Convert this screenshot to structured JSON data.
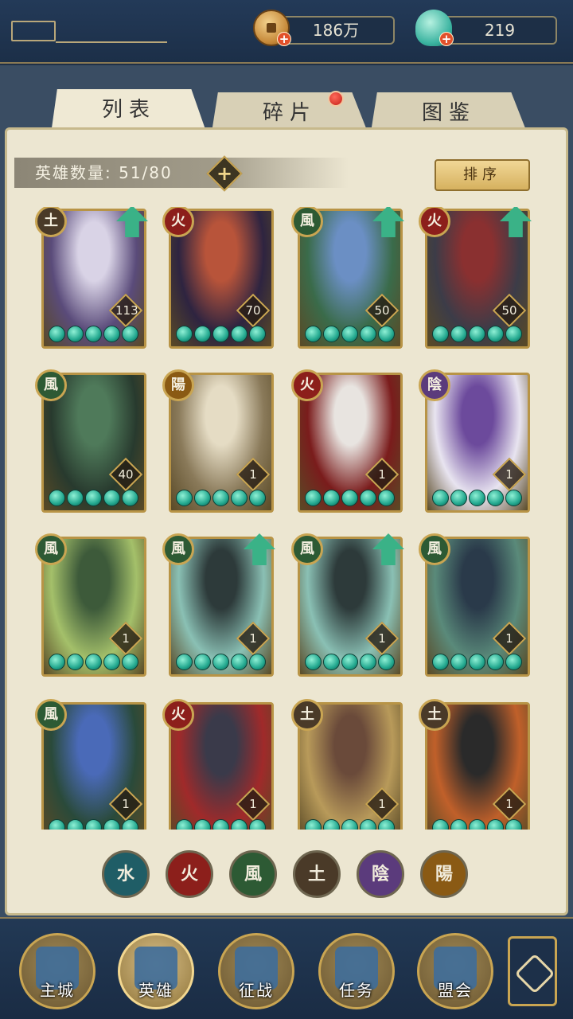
{
  "resources": {
    "coin": "186万",
    "jade": "219"
  },
  "tabs": [
    "列表",
    "碎片",
    "图鉴"
  ],
  "hero_count_label": "英雄数量: 51/80",
  "sort_label": "排序",
  "elements": {
    "earth": "土",
    "fire": "火",
    "wind": "風",
    "yin": "陰",
    "yang": "陽",
    "water": "水"
  },
  "heroes": [
    {
      "element": "earth",
      "glyph": "土",
      "level": "113",
      "upgrade": true,
      "colors": [
        "#d9d3e6",
        "#5a4b7a"
      ]
    },
    {
      "element": "fire",
      "glyph": "火",
      "level": "70",
      "upgrade": false,
      "colors": [
        "#b8543a",
        "#2e2440"
      ]
    },
    {
      "element": "wind",
      "glyph": "風",
      "level": "50",
      "upgrade": true,
      "colors": [
        "#6b8fc4",
        "#3a6b4a"
      ]
    },
    {
      "element": "fire",
      "glyph": "火",
      "level": "50",
      "upgrade": true,
      "colors": [
        "#8a3030",
        "#3c3c48"
      ]
    },
    {
      "element": "wind",
      "glyph": "風",
      "level": "40",
      "upgrade": false,
      "colors": [
        "#4f7a5a",
        "#283a2e"
      ]
    },
    {
      "element": "yang",
      "glyph": "陽",
      "level": "1",
      "upgrade": false,
      "colors": [
        "#e5dcc4",
        "#8a7a5a"
      ]
    },
    {
      "element": "fire",
      "glyph": "火",
      "level": "1",
      "upgrade": false,
      "colors": [
        "#e8e4e0",
        "#7a1c1c"
      ]
    },
    {
      "element": "yin",
      "glyph": "陰",
      "level": "1",
      "upgrade": false,
      "colors": [
        "#6c4a9c",
        "#e8e4f0"
      ]
    },
    {
      "element": "wind",
      "glyph": "風",
      "level": "1",
      "upgrade": false,
      "colors": [
        "#3d5a3a",
        "#a4c06a"
      ]
    },
    {
      "element": "wind",
      "glyph": "風",
      "level": "1",
      "upgrade": true,
      "colors": [
        "#2d3a3a",
        "#8ac0b4"
      ]
    },
    {
      "element": "wind",
      "glyph": "風",
      "level": "1",
      "upgrade": true,
      "colors": [
        "#2d3a3a",
        "#8ac0b4"
      ]
    },
    {
      "element": "wind",
      "glyph": "風",
      "level": "1",
      "upgrade": false,
      "colors": [
        "#2a3a4a",
        "#5a8a7a"
      ]
    },
    {
      "element": "wind",
      "glyph": "風",
      "level": "1",
      "upgrade": false,
      "colors": [
        "#4a6ab8",
        "#2a4a3a"
      ]
    },
    {
      "element": "fire",
      "glyph": "火",
      "level": "1",
      "upgrade": false,
      "colors": [
        "#3a3a4a",
        "#a02a2a"
      ]
    },
    {
      "element": "earth",
      "glyph": "土",
      "level": "1",
      "upgrade": false,
      "colors": [
        "#6a4a3a",
        "#b89a5a"
      ]
    },
    {
      "element": "earth",
      "glyph": "土",
      "level": "1",
      "upgrade": false,
      "colors": [
        "#2a2a2a",
        "#c0602a"
      ]
    }
  ],
  "filters": [
    {
      "element": "water",
      "glyph": "水"
    },
    {
      "element": "fire",
      "glyph": "火"
    },
    {
      "element": "wind",
      "glyph": "風"
    },
    {
      "element": "earth",
      "glyph": "土"
    },
    {
      "element": "yin",
      "glyph": "陰"
    },
    {
      "element": "yang",
      "glyph": "陽"
    }
  ],
  "nav": [
    {
      "label": "主城",
      "icon": "city-icon",
      "active": false
    },
    {
      "label": "英雄",
      "icon": "hero-icon",
      "active": true
    },
    {
      "label": "征战",
      "icon": "battle-icon",
      "active": false
    },
    {
      "label": "任务",
      "icon": "quest-icon",
      "active": false
    },
    {
      "label": "盟会",
      "icon": "guild-icon",
      "active": false
    }
  ],
  "colors": {
    "accent_gold": "#c9a552",
    "panel_bg": "#ece6d1",
    "nav_bg": "#1a2c44",
    "star_green": "#23a88f",
    "upgrade_arrow": "#3ab287"
  }
}
